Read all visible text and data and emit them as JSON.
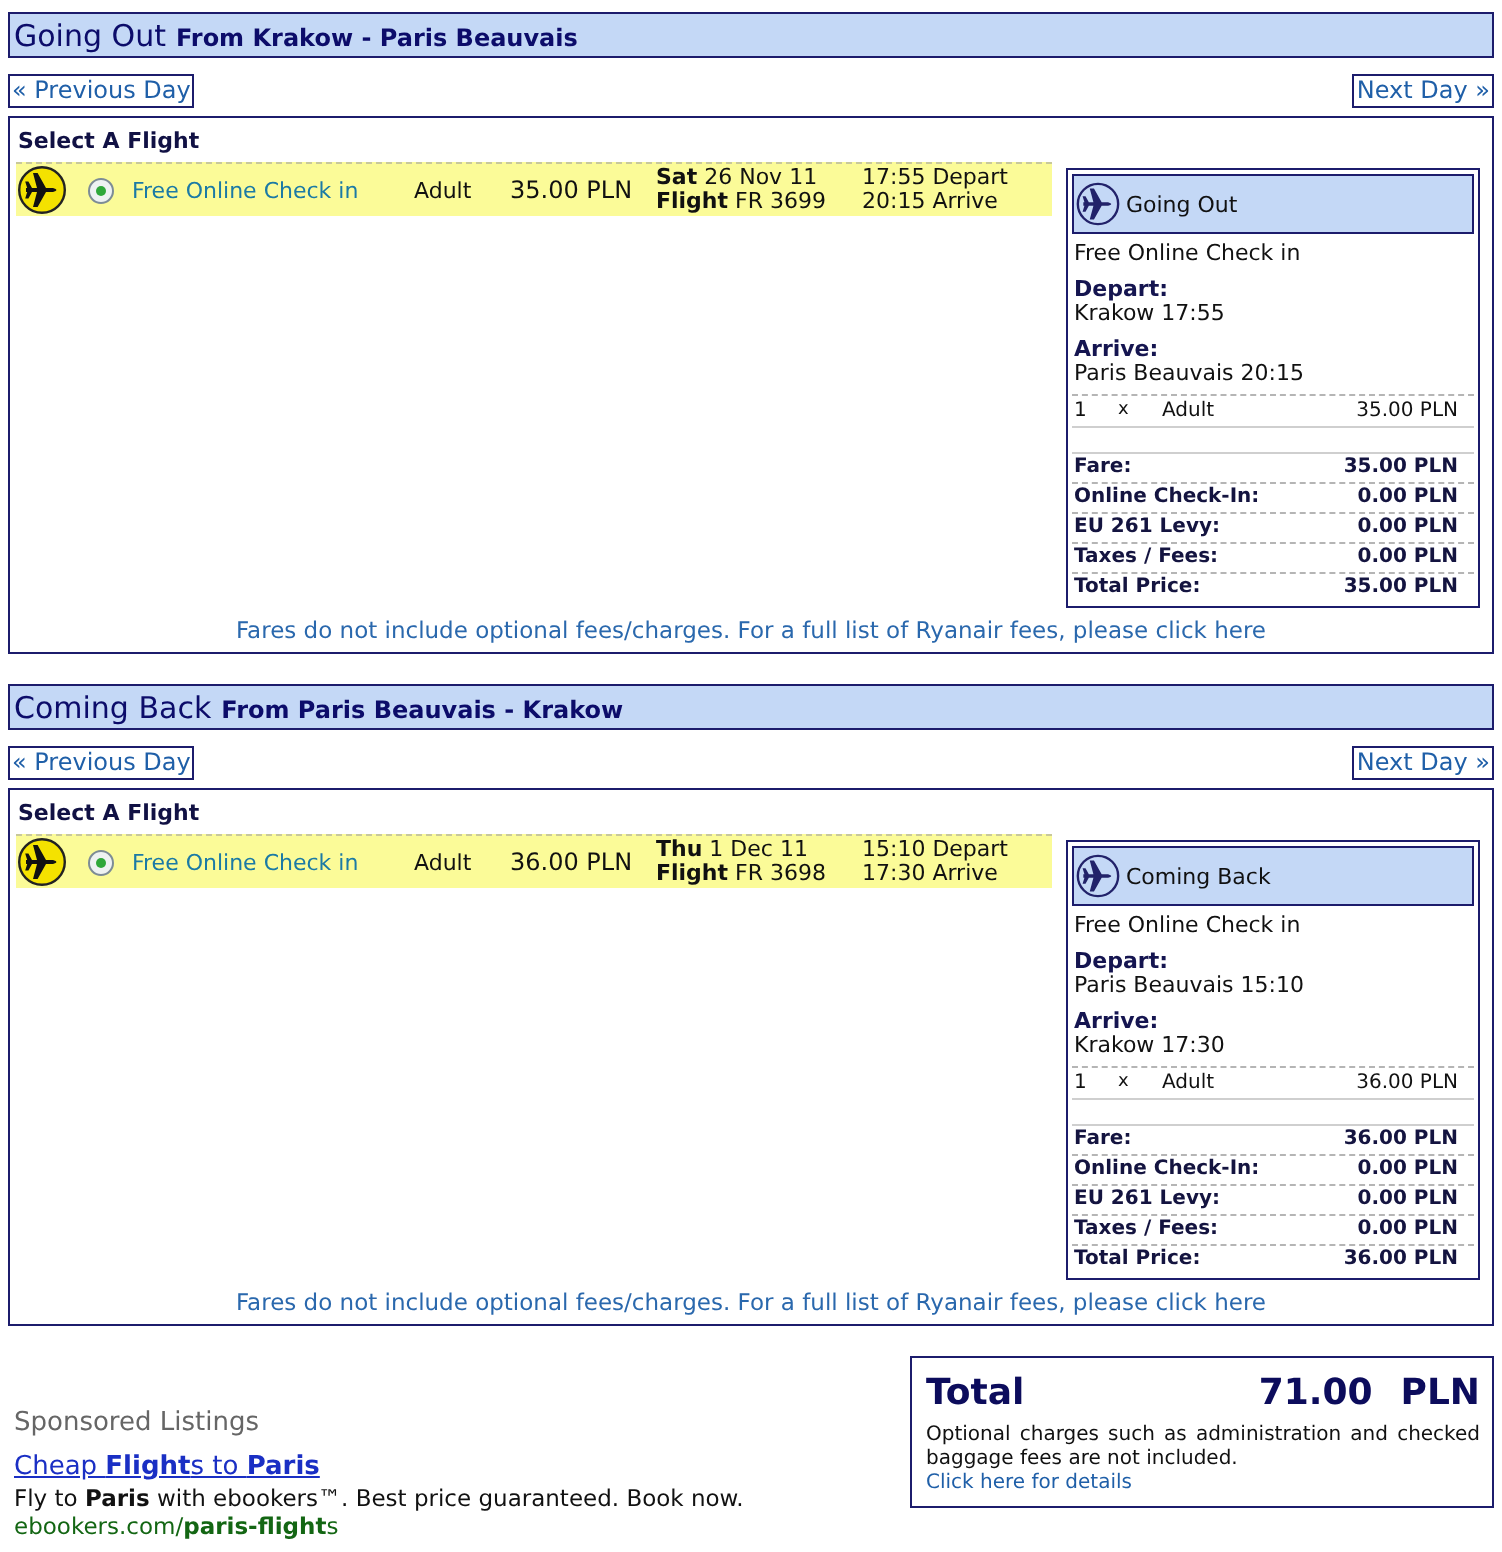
{
  "legs": [
    {
      "title": "Going Out",
      "route": "From Krakow - Paris Beauvais",
      "prev_day": "« Previous Day",
      "next_day": "Next Day »",
      "select_label": "Select A Flight",
      "flights": [
        {
          "selected": true,
          "fare_type": "Free Online Check in",
          "passenger": "Adult",
          "price": "35.00 PLN",
          "date": "**Sat** 26 Nov 11",
          "flight": "**Flight** FR 3699",
          "depart": "17:55 Depart",
          "arrive": "20:15 Arrive"
        }
      ],
      "summary": {
        "title": "Going Out",
        "fare_type": "Free Online Check in",
        "depart_label": "Depart:",
        "depart": "Krakow 17:55",
        "arrive_label": "Arrive:",
        "arrive": "Paris Beauvais 20:15",
        "passengers": [
          {
            "count": "1",
            "times": "x",
            "type": "Adult",
            "price": "35.00 PLN"
          }
        ],
        "costs": [
          {
            "label": "Fare:",
            "value": "35.00 PLN"
          },
          {
            "label": "Online Check-In:",
            "value": "0.00 PLN"
          },
          {
            "label": "EU 261 Levy:",
            "value": "0.00 PLN"
          },
          {
            "label": "Taxes / Fees:",
            "value": "0.00 PLN"
          },
          {
            "label": "Total Price:",
            "value": "35.00 PLN"
          }
        ]
      },
      "notice": "Fares do not include optional fees/charges. For a full list of Ryanair fees, please click here"
    },
    {
      "title": "Coming Back",
      "route": "From Paris Beauvais - Krakow",
      "prev_day": "« Previous Day",
      "next_day": "Next Day »",
      "select_label": "Select A Flight",
      "flights": [
        {
          "selected": true,
          "fare_type": "Free Online Check in",
          "passenger": "Adult",
          "price": "36.00 PLN",
          "date": "**Thu** 1 Dec 11",
          "flight": "**Flight** FR 3698",
          "depart": "15:10 Depart",
          "arrive": "17:30 Arrive"
        }
      ],
      "summary": {
        "title": "Coming Back",
        "fare_type": "Free Online Check in",
        "depart_label": "Depart:",
        "depart": "Paris Beauvais 15:10",
        "arrive_label": "Arrive:",
        "arrive": "Krakow 17:30",
        "passengers": [
          {
            "count": "1",
            "times": "x",
            "type": "Adult",
            "price": "36.00 PLN"
          }
        ],
        "costs": [
          {
            "label": "Fare:",
            "value": "36.00 PLN"
          },
          {
            "label": "Online Check-In:",
            "value": "0.00 PLN"
          },
          {
            "label": "EU 261 Levy:",
            "value": "0.00 PLN"
          },
          {
            "label": "Taxes / Fees:",
            "value": "0.00 PLN"
          },
          {
            "label": "Total Price:",
            "value": "36.00 PLN"
          }
        ]
      },
      "notice": "Fares do not include optional fees/charges. For a full list of Ryanair fees, please click here"
    }
  ],
  "sponsored": {
    "heading": "Sponsored Listings",
    "ads": [
      {
        "title": "Cheap **Flight**s to **Paris**",
        "text": "Fly to **Paris** with ebookers™. Best price guaranteed. Book now.",
        "url": "ebookers.com/**paris-flight**s"
      }
    ]
  },
  "total": {
    "label": "Total",
    "amount": "71.00",
    "currency": "PLN",
    "note": "Optional charges such as administration and checked baggage fees are not included.",
    "details_link": "Click here for details"
  }
}
